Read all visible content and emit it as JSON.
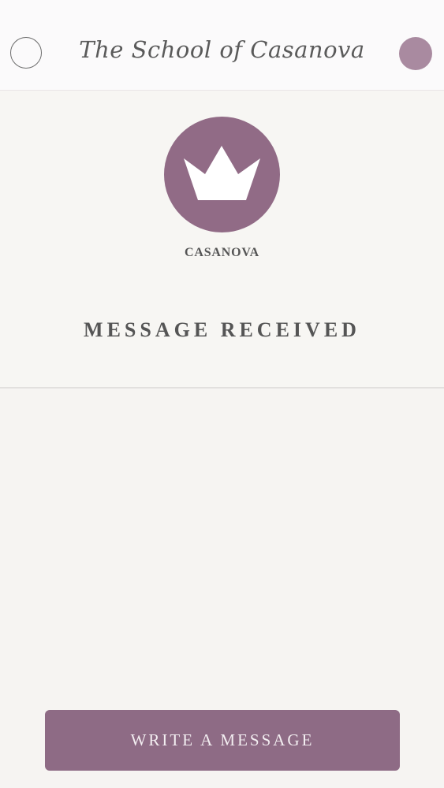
{
  "header": {
    "title": "The School of Casanova",
    "left_button_icon": "circle-outline-icon",
    "right_button_icon": "circle-filled-icon"
  },
  "profile": {
    "avatar_icon": "crown-icon",
    "name": "CASANOVA"
  },
  "status": {
    "text": "MESSAGE RECEIVED"
  },
  "actions": {
    "write_label": "WRITE A MESSAGE"
  },
  "colors": {
    "accent": "#916b86",
    "header_dot": "#a98aa0",
    "background": "#f6f4f2",
    "text": "#555555"
  }
}
